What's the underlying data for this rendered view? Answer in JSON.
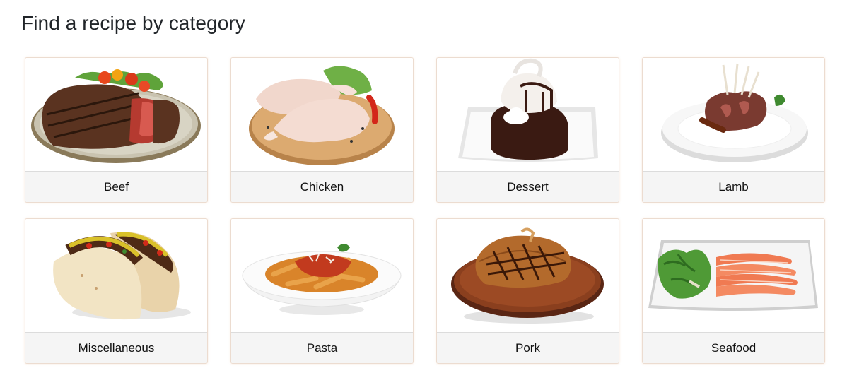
{
  "header": {
    "title": "Find a recipe by category"
  },
  "categories": [
    {
      "label": "Beef",
      "image": "grilled-steak-plate"
    },
    {
      "label": "Chicken",
      "image": "raw-chicken-board"
    },
    {
      "label": "Dessert",
      "image": "chocolate-lava-cake"
    },
    {
      "label": "Lamb",
      "image": "lamb-chops-plate"
    },
    {
      "label": "Miscellaneous",
      "image": "tacos"
    },
    {
      "label": "Pasta",
      "image": "penne-bowl"
    },
    {
      "label": "Pork",
      "image": "pork-chop-board"
    },
    {
      "label": "Seafood",
      "image": "salmon-salad-plate"
    }
  ]
}
